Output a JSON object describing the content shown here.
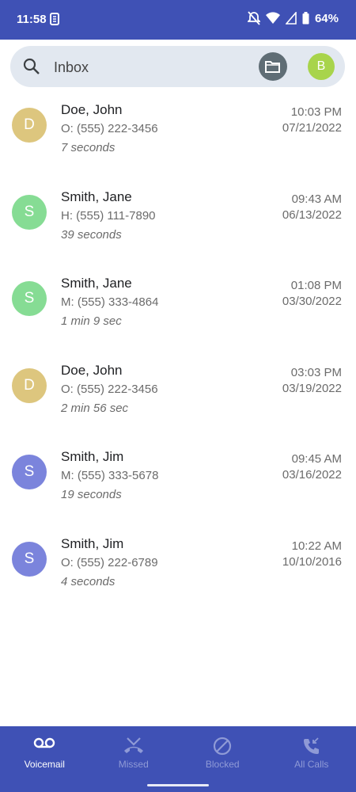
{
  "status": {
    "time": "11:58",
    "battery": "64%"
  },
  "search": {
    "placeholder": "Inbox"
  },
  "account": {
    "initial": "B",
    "color": "#a8d44b"
  },
  "voicemails": [
    {
      "initial": "D",
      "color": "#ddc67e",
      "name": "Doe, John",
      "number": "O: (555) 222-3456",
      "duration": "7 seconds",
      "time": "10:03 PM",
      "date": "07/21/2022"
    },
    {
      "initial": "S",
      "color": "#86dc94",
      "name": "Smith, Jane",
      "number": "H: (555) 111-7890",
      "duration": "39 seconds",
      "time": "09:43 AM",
      "date": "06/13/2022"
    },
    {
      "initial": "S",
      "color": "#86dc94",
      "name": "Smith, Jane",
      "number": "M: (555) 333-4864",
      "duration": "1 min 9 sec",
      "time": "01:08 PM",
      "date": "03/30/2022"
    },
    {
      "initial": "D",
      "color": "#ddc67e",
      "name": "Doe, John",
      "number": "O: (555) 222-3456",
      "duration": "2 min 56 sec",
      "time": "03:03 PM",
      "date": "03/19/2022"
    },
    {
      "initial": "S",
      "color": "#7b84dc",
      "name": "Smith, Jim",
      "number": "M: (555) 333-5678",
      "duration": "19 seconds",
      "time": "09:45 AM",
      "date": "03/16/2022"
    },
    {
      "initial": "S",
      "color": "#7b84dc",
      "name": "Smith, Jim",
      "number": "O: (555) 222-6789",
      "duration": "4 seconds",
      "time": "10:22 AM",
      "date": "10/10/2016"
    }
  ],
  "nav": {
    "voicemail": "Voicemail",
    "missed": "Missed",
    "blocked": "Blocked",
    "all_calls": "All Calls"
  },
  "colors": {
    "primary": "#3f51b5",
    "inactive_nav": "#8f9ad6"
  }
}
